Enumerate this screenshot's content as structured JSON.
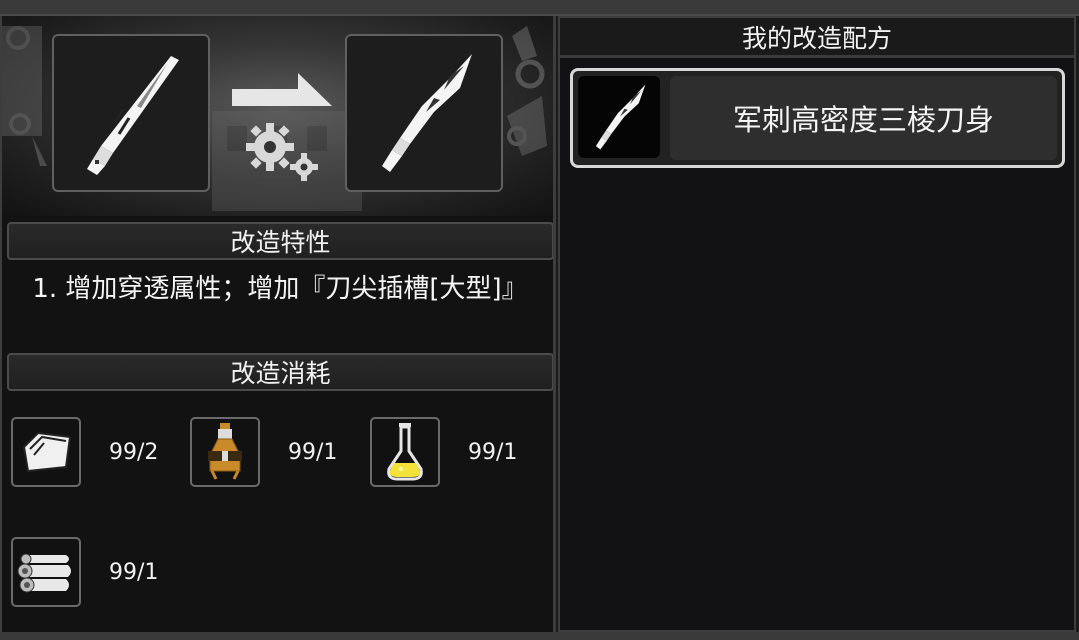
{
  "left": {
    "traits_header": "改造特性",
    "traits_text": "1. 增加穿透属性；增加『刀尖插槽[大型]』",
    "cost_header": "改造消耗",
    "costs": [
      {
        "icon": "paper-icon",
        "qty": "99/2"
      },
      {
        "icon": "brown-flask-icon",
        "qty": "99/1"
      },
      {
        "icon": "yellow-flask-icon",
        "qty": "99/1"
      },
      {
        "icon": "cloth-roll-icon",
        "qty": "99/1"
      }
    ]
  },
  "right": {
    "header": "我的改造配方",
    "recipes": [
      {
        "label": "军刺高密度三棱刀身"
      }
    ]
  },
  "colors": {
    "flask_brown": "#c98a2a",
    "flask_yellow": "#f2e23a",
    "selected_border": "#d8d8d8"
  }
}
